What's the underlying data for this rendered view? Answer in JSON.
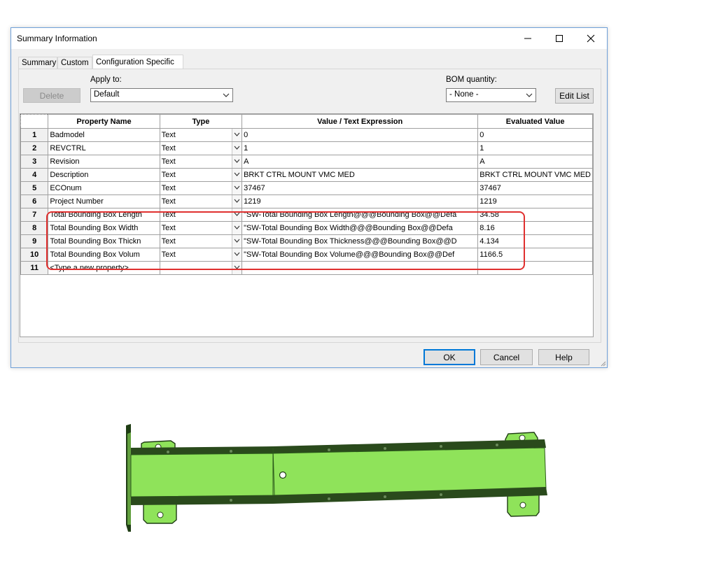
{
  "window": {
    "title": "Summary Information"
  },
  "tabs": [
    {
      "label": "Summary"
    },
    {
      "label": "Custom"
    },
    {
      "label": "Configuration Specific"
    }
  ],
  "toolbar": {
    "delete_label": "Delete",
    "apply_to_label": "Apply to:",
    "apply_to_value": "Default",
    "bom_label": "BOM quantity:",
    "bom_value": "- None -",
    "edit_list_label": "Edit List"
  },
  "table": {
    "headers": [
      "Property Name",
      "Type",
      "Value / Text Expression",
      "Evaluated Value"
    ],
    "rows": [
      {
        "num": "1",
        "name": "Badmodel",
        "type": "Text",
        "value": "0",
        "evaluated": "0"
      },
      {
        "num": "2",
        "name": "REVCTRL",
        "type": "Text",
        "value": "1",
        "evaluated": "1"
      },
      {
        "num": "3",
        "name": "Revision",
        "type": "Text",
        "value": "A",
        "evaluated": "A"
      },
      {
        "num": "4",
        "name": "Description",
        "type": "Text",
        "value": "BRKT CTRL MOUNT VMC MED",
        "evaluated": "BRKT CTRL MOUNT VMC MED"
      },
      {
        "num": "5",
        "name": "ECOnum",
        "type": "Text",
        "value": "37467",
        "evaluated": "37467"
      },
      {
        "num": "6",
        "name": "Project Number",
        "type": "Text",
        "value": "1219",
        "evaluated": "1219"
      },
      {
        "num": "7",
        "name": "Total Bounding Box Length",
        "type": "Text",
        "value": "\"SW-Total Bounding Box Length@@@Bounding Box@@Defa",
        "evaluated": "34.58"
      },
      {
        "num": "8",
        "name": "Total Bounding Box Width",
        "type": "Text",
        "value": "\"SW-Total Bounding Box Width@@@Bounding Box@@Defa",
        "evaluated": "8.16"
      },
      {
        "num": "9",
        "name": "Total Bounding Box Thickn",
        "type": "Text",
        "value": "\"SW-Total Bounding Box Thickness@@@Bounding Box@@D",
        "evaluated": "4.134"
      },
      {
        "num": "10",
        "name": "Total Bounding Box Volum",
        "type": "Text",
        "value": "\"SW-Total Bounding Box Volume@@@Bounding Box@@Def",
        "evaluated": "1166.5"
      },
      {
        "num": "11",
        "name": "<Type a new property>",
        "type": "",
        "value": "",
        "evaluated": ""
      }
    ]
  },
  "footer": {
    "ok_label": "OK",
    "cancel_label": "Cancel",
    "help_label": "Help"
  },
  "colors": {
    "highlight": "#e0302f",
    "part_green": "#8fe35a",
    "part_dark": "#1f3d14"
  }
}
